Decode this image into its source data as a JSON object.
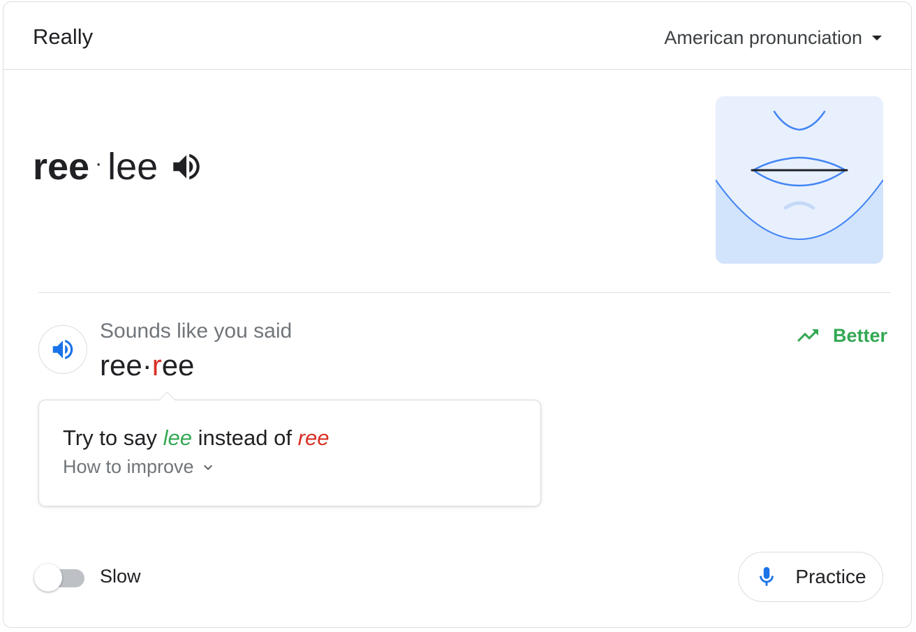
{
  "header": {
    "word": "Really",
    "accent_select": "American pronunciation"
  },
  "phonetic": {
    "syllables": [
      "ree",
      "lee"
    ],
    "separator": "·"
  },
  "feedback": {
    "sounds_label": "Sounds like you said",
    "heard_syllables": [
      "ree",
      "r",
      "ee"
    ],
    "separator": "·",
    "rating": "Better"
  },
  "tip": {
    "prefix": "Try to say",
    "correct": "lee",
    "middle": "instead of",
    "incorrect": "ree",
    "how_to_improve": "How to improve"
  },
  "controls": {
    "slow_label": "Slow",
    "slow_enabled": false,
    "practice_label": "Practice"
  },
  "icons": {
    "speaker": "speaker-icon",
    "play": "speaker-icon",
    "trend": "trending-up-icon",
    "chevron": "chevron-down-icon",
    "mic": "microphone-icon",
    "caret": "caret-down-icon"
  },
  "colors": {
    "good": "#34a853",
    "bad": "#d93025",
    "accent": "#1a73e8"
  }
}
